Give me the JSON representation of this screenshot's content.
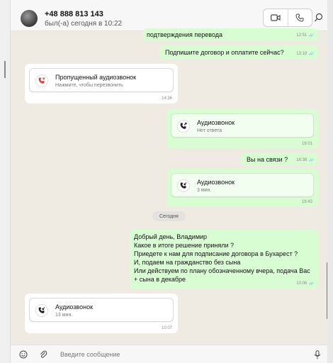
{
  "contact": {
    "phone": "+48 888 813 143",
    "last_seen": "был(-а) сегодня в 10:22"
  },
  "messages": [
    {
      "type": "text",
      "dir": "out",
      "text": "подтверждения перевода",
      "time": "12:51",
      "read": true
    },
    {
      "type": "text",
      "dir": "out",
      "text": "Подпишите договор и оплатите сейчас?",
      "time": "13:19",
      "read": true
    },
    {
      "type": "call",
      "dir": "in",
      "title": "Пропущенный аудиозвонок",
      "subtitle": "Нажмите, чтобы перезвонить",
      "time": "14:36",
      "icon": "missed-call-icon"
    },
    {
      "type": "call",
      "dir": "out",
      "title": "Аудиозвонок",
      "subtitle": "Нет ответа",
      "time": "16:01",
      "icon": "outgoing-call-icon"
    },
    {
      "type": "text",
      "dir": "out",
      "text": "Вы на связи ?",
      "time": "16:38",
      "read": true
    },
    {
      "type": "call",
      "dir": "out",
      "title": "Аудиозвонок",
      "subtitle": "3 мин.",
      "time": "16:43",
      "icon": "incoming-call-icon"
    },
    {
      "type": "text",
      "dir": "out",
      "lines": [
        "Добрый день, Владимир",
        "Какое в итоге решение приняли ?",
        "Приедете к нам для подписание договора в Бухарест ?",
        "И, подаем на гражданство без сына",
        "Или действуем по плану обозначенному вчера, подача Вас",
        "+ сына в декабре"
      ],
      "time": "10:06",
      "read": true
    },
    {
      "type": "call",
      "dir": "in",
      "title": "Аудиозвонок",
      "subtitle": "13 мин.",
      "time": "10:07",
      "icon": "incoming-call-icon"
    }
  ],
  "day_separator": "Сегодня",
  "composer": {
    "placeholder": "Введите сообщение"
  },
  "colors": {
    "outgoing_bubble": "#d9fdd3",
    "incoming_bubble": "#ffffff",
    "read_tick": "#53bdeb",
    "chat_bg": "#efeae2"
  }
}
